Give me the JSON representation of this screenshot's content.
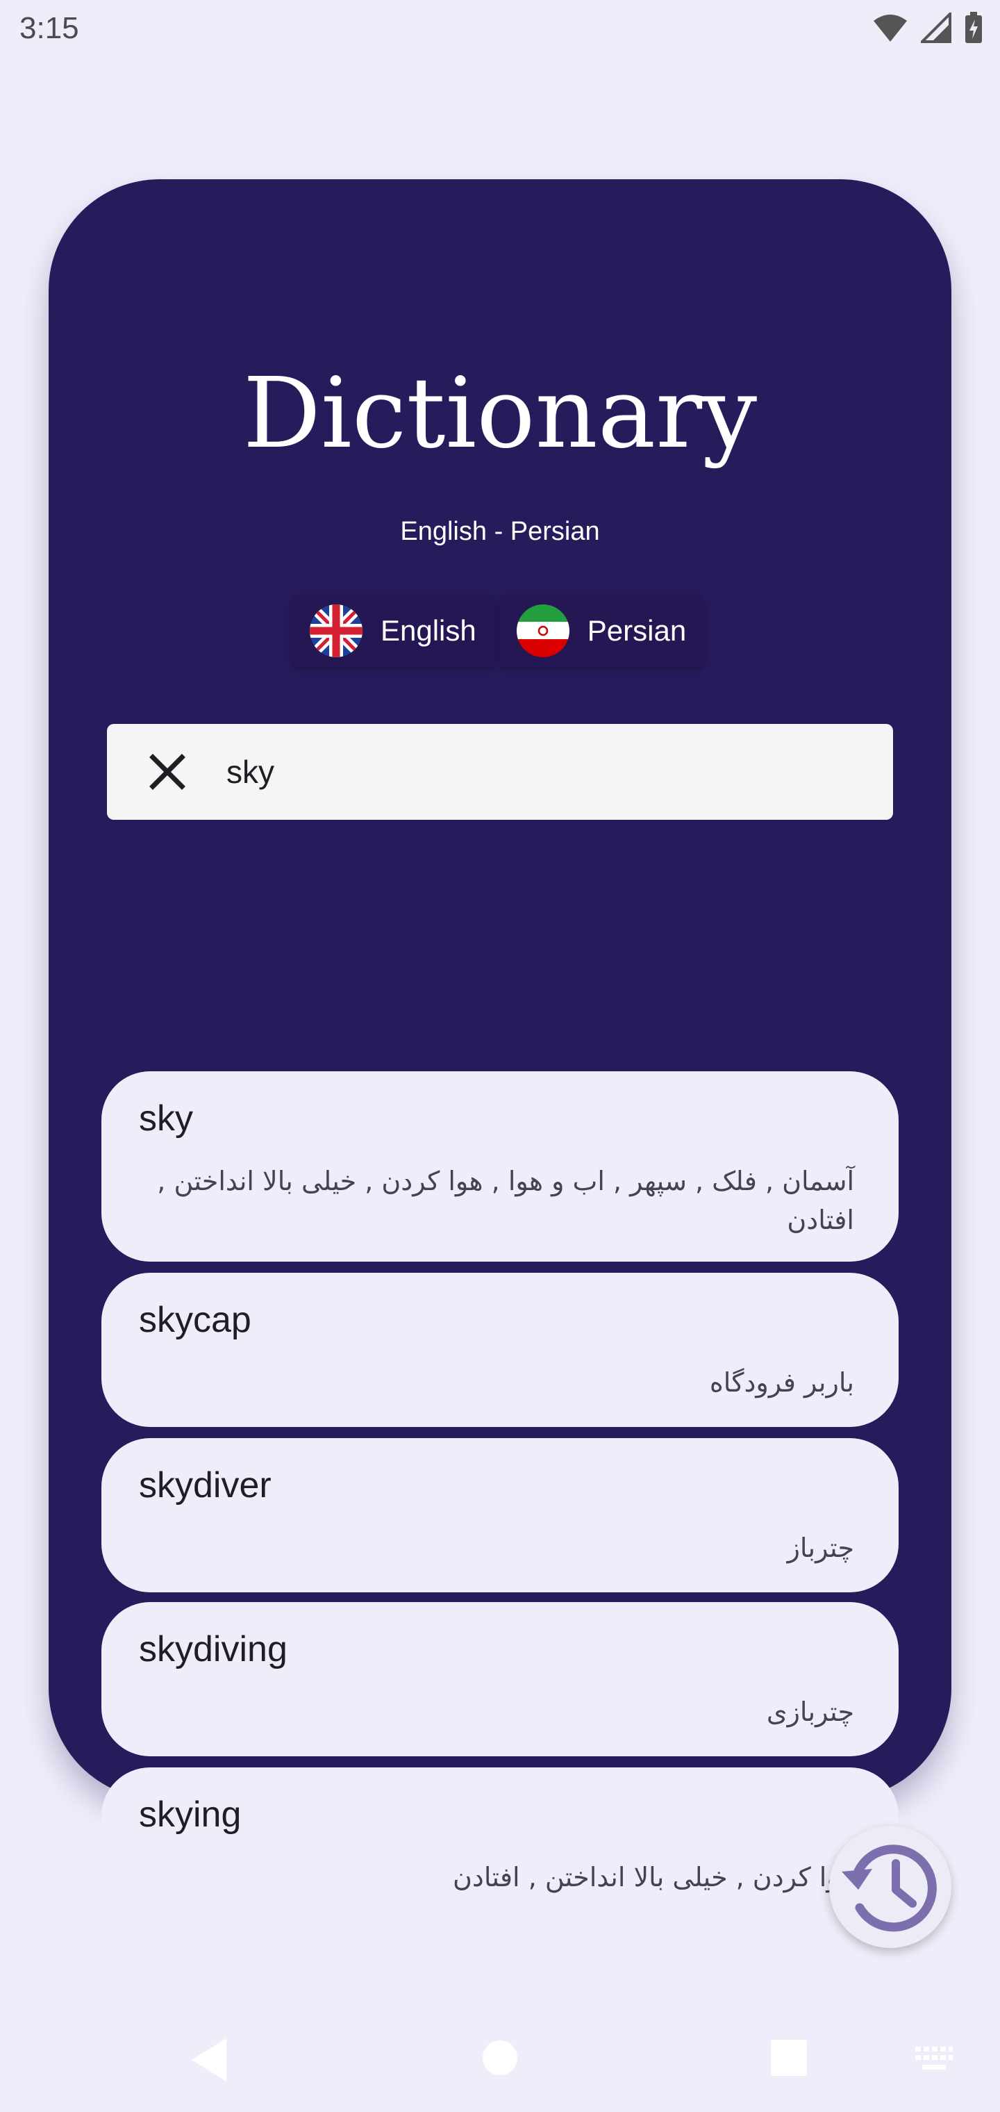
{
  "status_bar": {
    "time": "3:15",
    "icons": [
      "wifi-icon",
      "cellular-signal-icon",
      "battery-charging-icon"
    ]
  },
  "header": {
    "title": "Dictionary",
    "subtitle": "English - Persian"
  },
  "languages": [
    {
      "label": "English",
      "flag": "uk-flag-icon"
    },
    {
      "label": "Persian",
      "flag": "iran-flag-icon"
    }
  ],
  "search": {
    "value": "sky",
    "clear_icon": "close-icon"
  },
  "results": [
    {
      "word": "sky",
      "meaning": "آسمان , فلک , سپهر , اب و هوا , هوا کردن , خیلی بالا انداختن , افتادن"
    },
    {
      "word": "skycap",
      "meaning": "باربر فرودگاه"
    },
    {
      "word": "skydiver",
      "meaning": "چترباز"
    },
    {
      "word": "skydiving",
      "meaning": "چتربازی"
    },
    {
      "word": "skying",
      "meaning": "هوا کردن , خیلی بالا انداختن , افتادن"
    }
  ],
  "fab": {
    "icon": "history-icon"
  },
  "navigation": {
    "buttons": [
      "back-icon",
      "home-icon",
      "recents-icon",
      "keyboard-icon"
    ]
  },
  "colors": {
    "background": "#eeedfa",
    "card": "#271b5c",
    "result_item": "#eeedfa",
    "search_field": "#f5f5f5",
    "accent": "#7d6fae"
  }
}
